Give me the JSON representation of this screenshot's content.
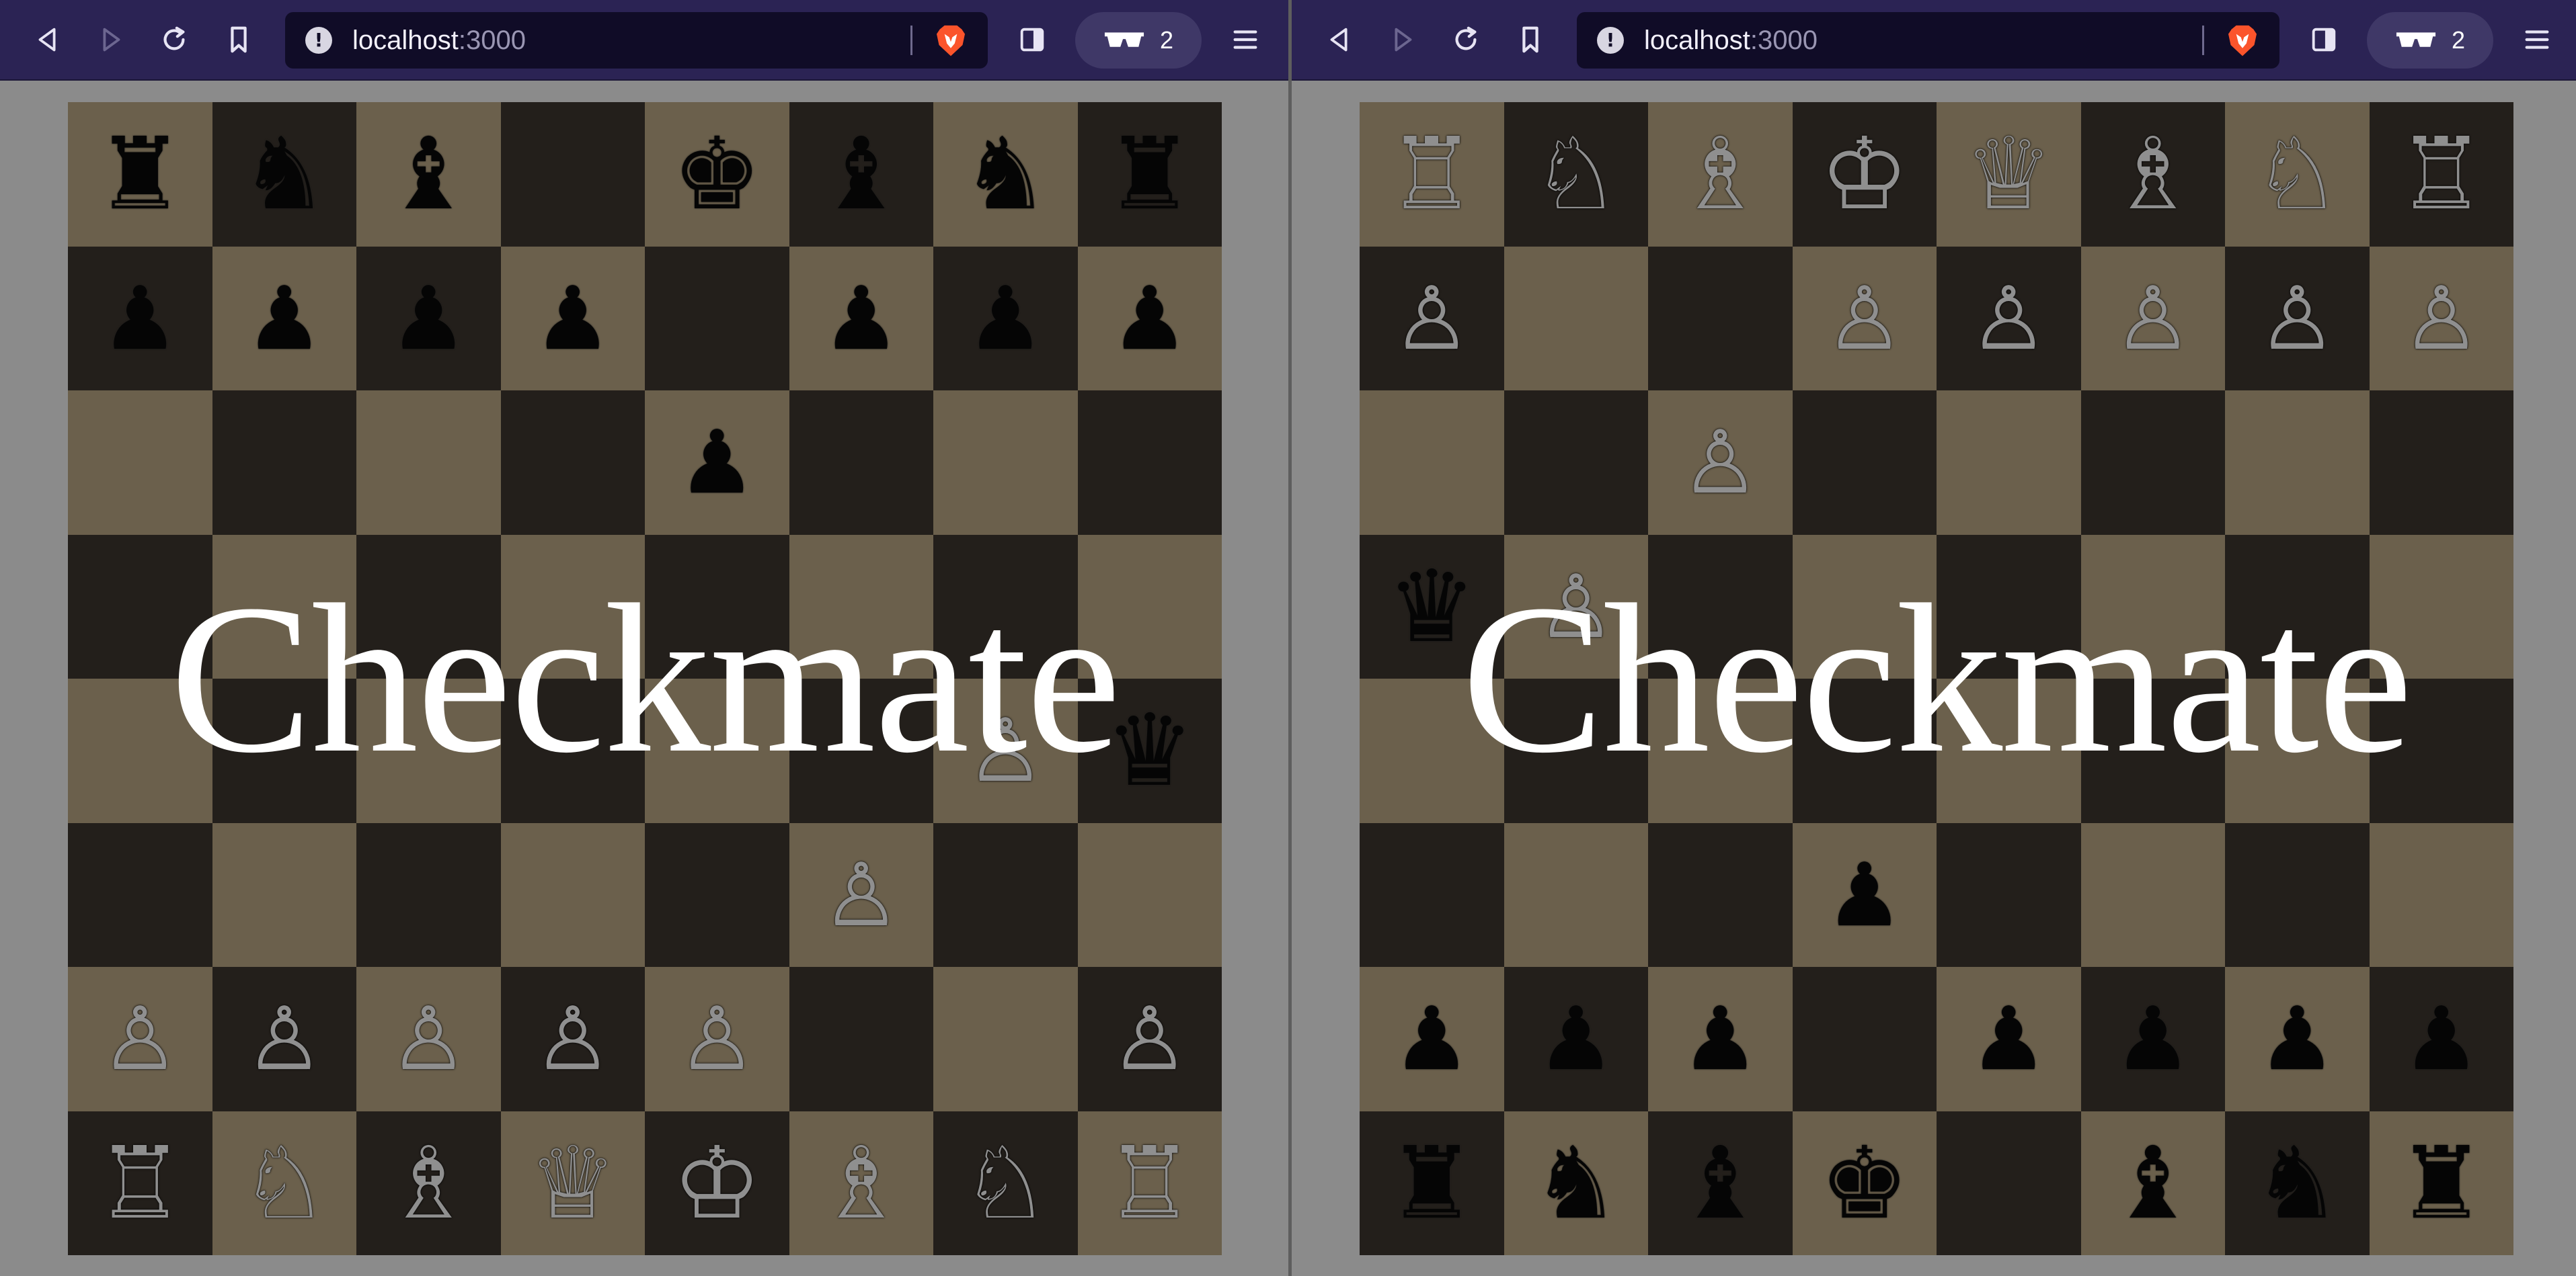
{
  "windows": [
    {
      "url": {
        "host": "localhost",
        "port": ":3000"
      },
      "vpn_count": "2",
      "overlay": "Checkmate",
      "ranks": [
        [
          {
            "c": "black",
            "g": "♜"
          },
          {
            "c": "black",
            "g": "♞"
          },
          {
            "c": "black",
            "g": "♝"
          },
          null,
          {
            "c": "black",
            "g": "♚"
          },
          {
            "c": "black",
            "g": "♝"
          },
          {
            "c": "black",
            "g": "♞"
          },
          {
            "c": "black",
            "g": "♜"
          }
        ],
        [
          {
            "c": "black",
            "g": "♟"
          },
          {
            "c": "black",
            "g": "♟"
          },
          {
            "c": "black",
            "g": "♟"
          },
          {
            "c": "black",
            "g": "♟"
          },
          null,
          {
            "c": "black",
            "g": "♟"
          },
          {
            "c": "black",
            "g": "♟"
          },
          {
            "c": "black",
            "g": "♟"
          }
        ],
        [
          null,
          null,
          null,
          null,
          {
            "c": "black",
            "g": "♟"
          },
          null,
          null,
          null
        ],
        [
          null,
          null,
          null,
          null,
          null,
          null,
          null,
          null
        ],
        [
          null,
          null,
          null,
          null,
          null,
          null,
          {
            "c": "grey",
            "g": "♙"
          },
          {
            "c": "black",
            "g": "♛"
          }
        ],
        [
          null,
          null,
          null,
          null,
          null,
          {
            "c": "grey",
            "g": "♙"
          },
          null,
          null
        ],
        [
          {
            "c": "grey",
            "g": "♙"
          },
          {
            "c": "grey",
            "g": "♙"
          },
          {
            "c": "grey",
            "g": "♙"
          },
          {
            "c": "grey",
            "g": "♙"
          },
          {
            "c": "grey",
            "g": "♙"
          },
          null,
          null,
          {
            "c": "grey",
            "g": "♙"
          }
        ],
        [
          {
            "c": "grey",
            "g": "♖"
          },
          {
            "c": "grey",
            "g": "♘"
          },
          {
            "c": "grey",
            "g": "♗"
          },
          {
            "c": "grey",
            "g": "♕"
          },
          {
            "c": "grey",
            "g": "♔"
          },
          {
            "c": "grey",
            "g": "♗"
          },
          {
            "c": "grey",
            "g": "♘"
          },
          {
            "c": "grey",
            "g": "♖"
          }
        ]
      ]
    },
    {
      "url": {
        "host": "localhost",
        "port": ":3000"
      },
      "vpn_count": "2",
      "overlay": "Checkmate",
      "ranks": [
        [
          {
            "c": "grey",
            "g": "♖"
          },
          {
            "c": "grey",
            "g": "♘"
          },
          {
            "c": "grey",
            "g": "♗"
          },
          {
            "c": "grey",
            "g": "♔"
          },
          {
            "c": "grey",
            "g": "♕"
          },
          {
            "c": "grey",
            "g": "♗"
          },
          {
            "c": "grey",
            "g": "♘"
          },
          {
            "c": "grey",
            "g": "♖"
          }
        ],
        [
          {
            "c": "grey",
            "g": "♙"
          },
          null,
          null,
          {
            "c": "grey",
            "g": "♙"
          },
          {
            "c": "grey",
            "g": "♙"
          },
          {
            "c": "grey",
            "g": "♙"
          },
          {
            "c": "grey",
            "g": "♙"
          },
          {
            "c": "grey",
            "g": "♙"
          }
        ],
        [
          null,
          null,
          {
            "c": "grey",
            "g": "♙"
          },
          null,
          null,
          null,
          null,
          null
        ],
        [
          {
            "c": "black",
            "g": "♛"
          },
          {
            "c": "grey",
            "g": "♙"
          },
          null,
          null,
          null,
          null,
          null,
          null
        ],
        [
          null,
          null,
          null,
          null,
          null,
          null,
          null,
          null
        ],
        [
          null,
          null,
          null,
          {
            "c": "black",
            "g": "♟"
          },
          null,
          null,
          null,
          null
        ],
        [
          {
            "c": "black",
            "g": "♟"
          },
          {
            "c": "black",
            "g": "♟"
          },
          {
            "c": "black",
            "g": "♟"
          },
          null,
          {
            "c": "black",
            "g": "♟"
          },
          {
            "c": "black",
            "g": "♟"
          },
          {
            "c": "black",
            "g": "♟"
          },
          {
            "c": "black",
            "g": "♟"
          }
        ],
        [
          {
            "c": "black",
            "g": "♜"
          },
          {
            "c": "black",
            "g": "♞"
          },
          {
            "c": "black",
            "g": "♝"
          },
          {
            "c": "black",
            "g": "♚"
          },
          null,
          {
            "c": "black",
            "g": "♝"
          },
          {
            "c": "black",
            "g": "♞"
          },
          {
            "c": "black",
            "g": "♜"
          }
        ]
      ]
    }
  ],
  "colors": {
    "toolbar": "#2b2354",
    "urlbar": "#100c27",
    "light_square": "#6b604c",
    "dark_square": "#231f1b",
    "page_background": "#8b8b8b",
    "overlay_text": "#ffffff"
  },
  "icons": {
    "back": "back-icon",
    "forward": "forward-icon",
    "reload": "reload-icon",
    "bookmark": "bookmark-icon",
    "site_info": "info-icon",
    "brave_shields": "brave-lion-icon",
    "sidebar": "sidebar-icon",
    "vpn": "glasses-icon",
    "menu": "hamburger-menu-icon"
  }
}
